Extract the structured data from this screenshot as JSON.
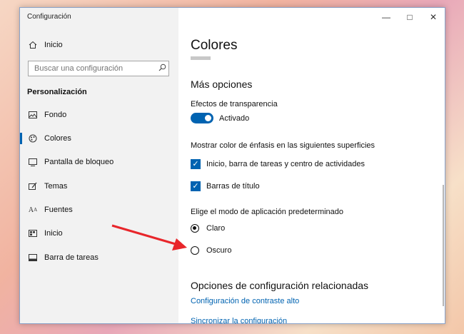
{
  "window": {
    "title": "Configuración"
  },
  "sidebar": {
    "home_label": "Inicio",
    "search_placeholder": "Buscar una configuración",
    "section_label": "Personalización",
    "items": [
      {
        "label": "Fondo",
        "icon": "image-icon"
      },
      {
        "label": "Colores",
        "icon": "palette-icon",
        "active": true
      },
      {
        "label": "Pantalla de bloqueo",
        "icon": "lock-screen-icon"
      },
      {
        "label": "Temas",
        "icon": "brush-icon"
      },
      {
        "label": "Fuentes",
        "icon": "font-icon"
      },
      {
        "label": "Inicio",
        "icon": "start-icon"
      },
      {
        "label": "Barra de tareas",
        "icon": "taskbar-icon"
      }
    ]
  },
  "main": {
    "title": "Colores",
    "more_options": "Más opciones",
    "transparency_label": "Efectos de transparencia",
    "transparency_state": "Activado",
    "accent_surfaces_label": "Mostrar color de énfasis en las siguientes superficies",
    "checkbox_start": "Inicio, barra de tareas y centro de actividades",
    "checkbox_titlebars": "Barras de título",
    "app_mode_label": "Elige el modo de aplicación predeterminado",
    "radio_light": "Claro",
    "radio_dark": "Oscuro",
    "related_title": "Opciones de configuración relacionadas",
    "link_contrast": "Configuración de contraste alto",
    "link_sync": "Sincronizar la configuración"
  },
  "colors": {
    "accent": "#0063b1",
    "arrow": "#e8262b"
  }
}
